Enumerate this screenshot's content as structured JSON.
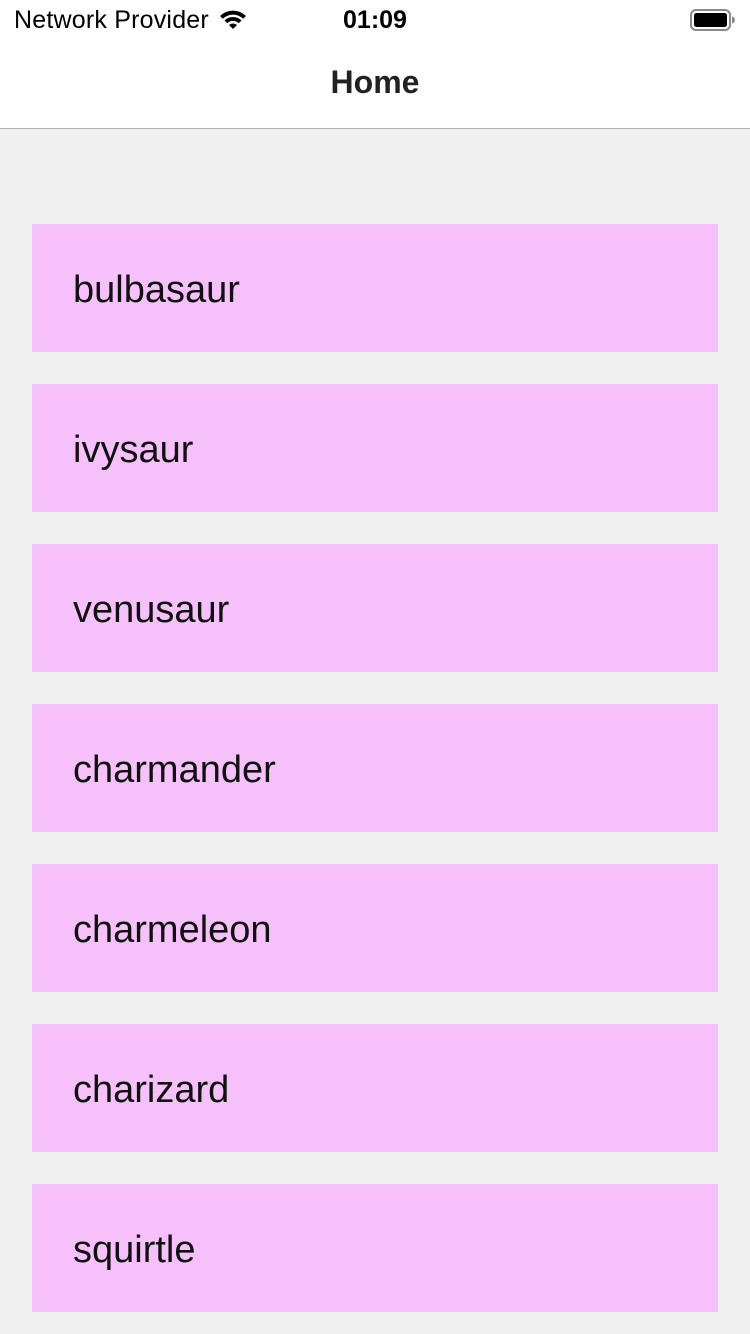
{
  "status_bar": {
    "carrier": "Network Provider",
    "time": "01:09",
    "wifi_icon": "wifi-icon",
    "battery_icon": "battery-icon"
  },
  "nav": {
    "title": "Home"
  },
  "list": {
    "item_color": "#f6c1fa",
    "background_color": "#f0f0f0",
    "items": [
      {
        "label": "bulbasaur"
      },
      {
        "label": "ivysaur"
      },
      {
        "label": "venusaur"
      },
      {
        "label": "charmander"
      },
      {
        "label": "charmeleon"
      },
      {
        "label": "charizard"
      },
      {
        "label": "squirtle"
      }
    ]
  }
}
